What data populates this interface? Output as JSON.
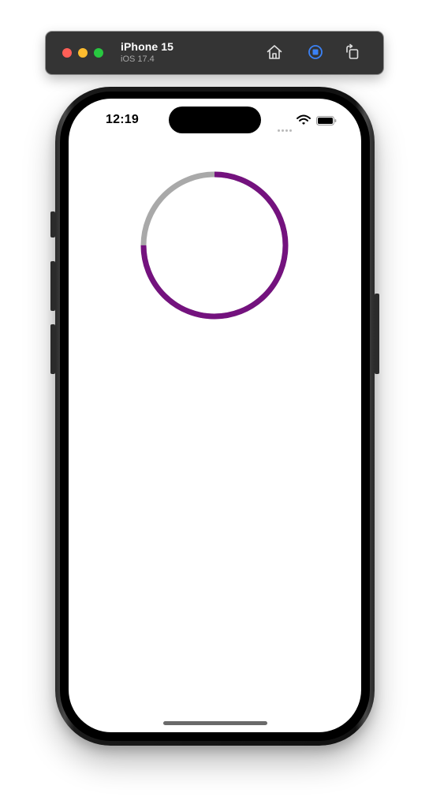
{
  "toolbar": {
    "device_name": "iPhone 15",
    "os_version": "iOS 17.4",
    "buttons": [
      "home-icon",
      "record-icon",
      "rotate-icon"
    ]
  },
  "status_bar": {
    "time": "12:19"
  },
  "progress_ring": {
    "progress": 0.75,
    "track_color": "#a9a9a9",
    "progress_color": "#74127e"
  },
  "colors": {
    "toolbar_bg": "#343434",
    "close": "#ff5f57",
    "minimize": "#febc2e",
    "zoom": "#28c840",
    "record_accent": "#3b82f6"
  }
}
